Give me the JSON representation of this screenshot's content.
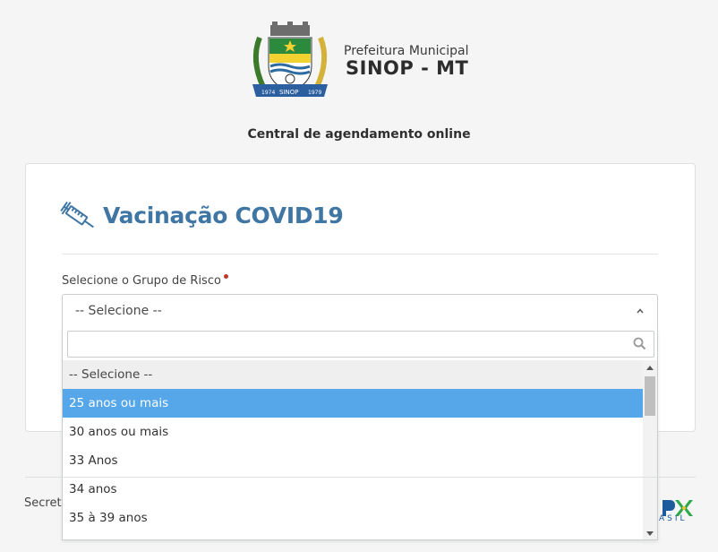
{
  "header": {
    "municipality": "Prefeitura Municipal",
    "city": "SINOP - MT",
    "subtitle": "Central de agendamento online",
    "crest": {
      "year_left": "1974",
      "name": "SINOP",
      "year_right": "1979"
    }
  },
  "card": {
    "title": "Vacinação COVID19",
    "field_label": "Selecione o Grupo de Risco",
    "select_value": "-- Selecione --",
    "search_placeholder": "",
    "options": [
      {
        "label": "-- Selecione --",
        "state": "placeholder"
      },
      {
        "label": "25 anos ou mais",
        "state": "active"
      },
      {
        "label": "30 anos ou mais",
        "state": ""
      },
      {
        "label": "33 Anos",
        "state": ""
      },
      {
        "label": "34 anos",
        "state": ""
      },
      {
        "label": "35 à 39 anos",
        "state": ""
      }
    ]
  },
  "footer": {
    "text": "Secret",
    "brand_partial": "ASIL"
  },
  "colors": {
    "title": "#3f76a3",
    "highlight": "#56a7e9",
    "background": "#f4f5f4"
  }
}
